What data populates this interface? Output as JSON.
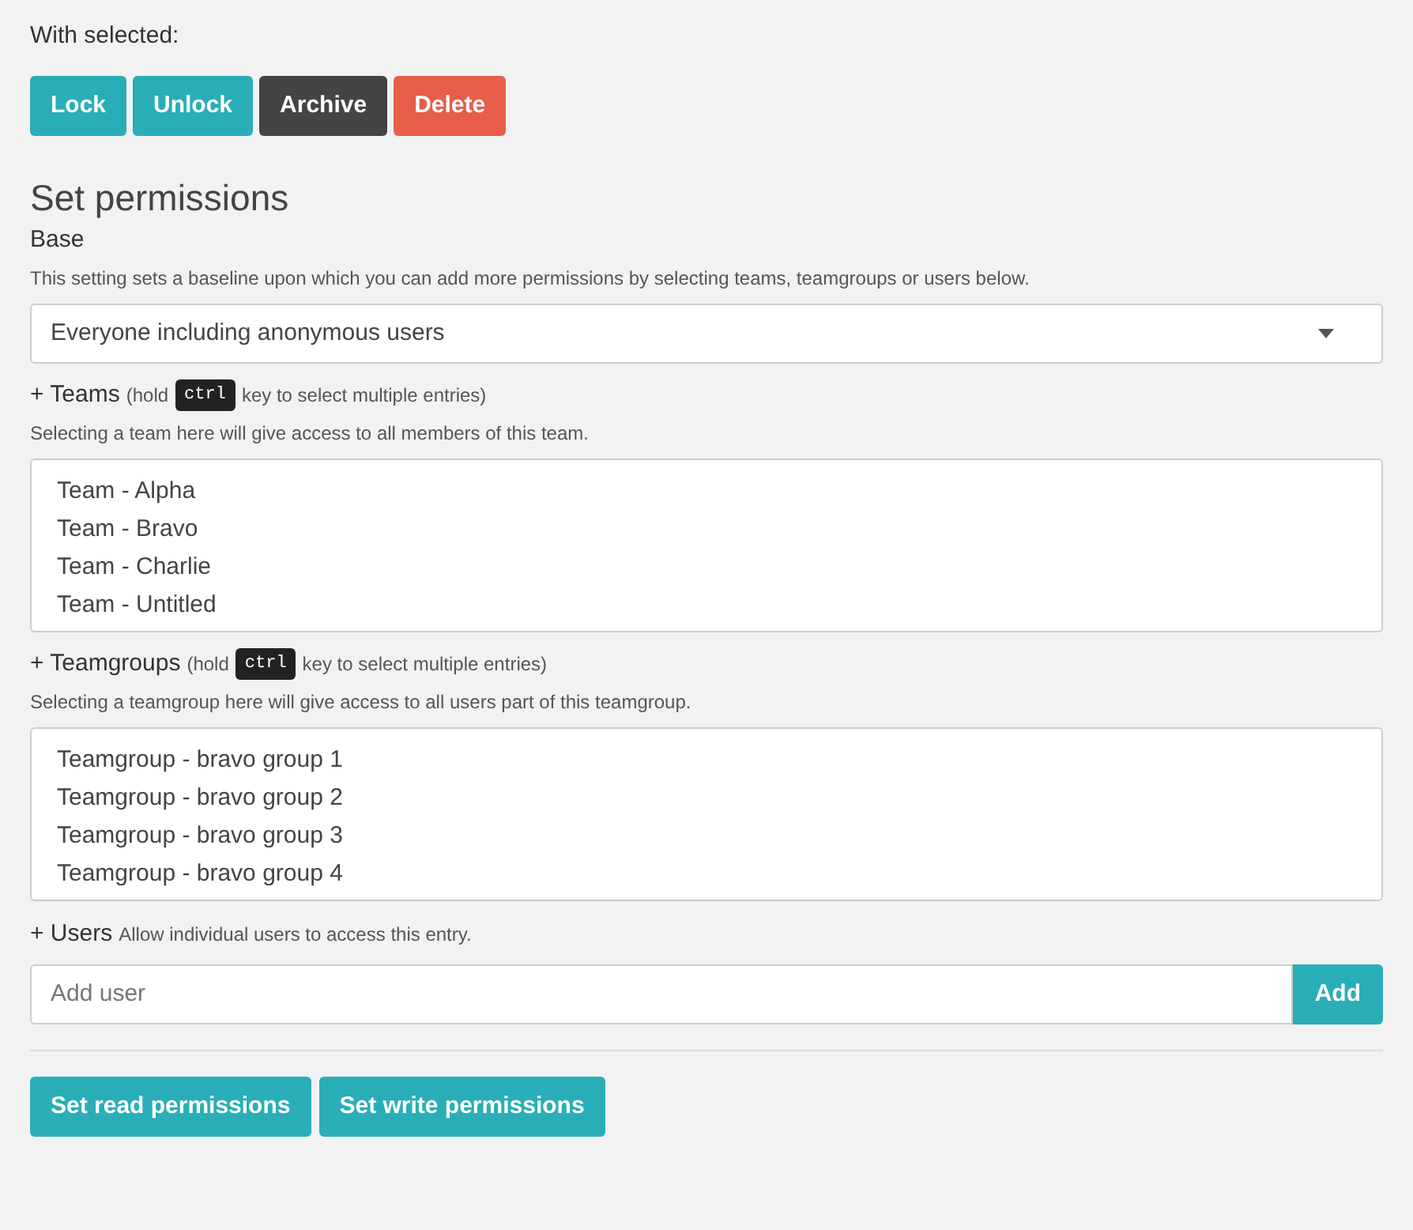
{
  "bulk_actions": {
    "label": "With selected:",
    "buttons": [
      {
        "label": "Lock",
        "kind": "primary"
      },
      {
        "label": "Unlock",
        "kind": "primary"
      },
      {
        "label": "Archive",
        "kind": "dark"
      },
      {
        "label": "Delete",
        "kind": "danger"
      }
    ]
  },
  "heading": "Set permissions",
  "base": {
    "label": "Base",
    "description": "This setting sets a baseline upon which you can add more permissions by selecting teams, teamgroups or users below.",
    "select_value": "Everyone including anonymous users"
  },
  "lists": [
    {
      "label": "+ Teams",
      "hint_before": "(hold",
      "key": "ctrl",
      "hint_after": "key to select multiple entries)",
      "description": "Selecting a team here will give access to all members of this team.",
      "options": [
        "Team - Alpha",
        "Team - Bravo",
        "Team - Charlie",
        "Team - Untitled"
      ]
    },
    {
      "label": "+ Teamgroups",
      "hint_before": "(hold",
      "key": "ctrl",
      "hint_after": "key to select multiple entries)",
      "description": "Selecting a teamgroup here will give access to all users part of this teamgroup.",
      "options": [
        "Teamgroup - bravo group 1",
        "Teamgroup - bravo group 2",
        "Teamgroup - bravo group 3",
        "Teamgroup - bravo group 4"
      ]
    }
  ],
  "users": {
    "label": "+ Users",
    "hint": "Allow individual users to access this entry.",
    "placeholder": "Add user",
    "button": "Add"
  },
  "footer_buttons": [
    "Set read permissions",
    "Set write permissions"
  ]
}
